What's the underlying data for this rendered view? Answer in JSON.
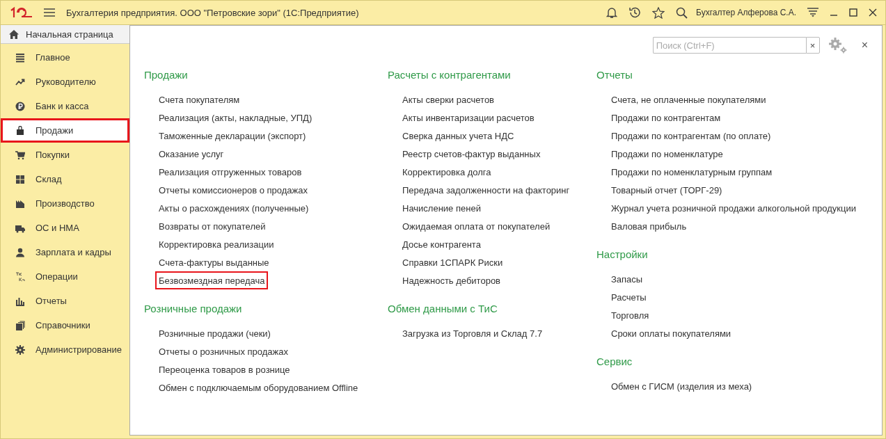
{
  "window": {
    "title": "Бухгалтерия предприятия. ООО \"Петровские зори\"  (1С:Предприятие)",
    "user": "Бухгалтер Алферова С.А."
  },
  "tabs": [
    {
      "label": "Начальная страница",
      "selected": false
    }
  ],
  "sidebar": {
    "items": [
      {
        "label": "Главное",
        "selected": false
      },
      {
        "label": "Руководителю",
        "selected": false
      },
      {
        "label": "Банк и касса",
        "selected": false
      },
      {
        "label": "Продажи",
        "selected": true
      },
      {
        "label": "Покупки",
        "selected": false
      },
      {
        "label": "Склад",
        "selected": false
      },
      {
        "label": "Производство",
        "selected": false
      },
      {
        "label": "ОС и НМА",
        "selected": false
      },
      {
        "label": "Зарплата и кадры",
        "selected": false
      },
      {
        "label": "Операции",
        "selected": false
      },
      {
        "label": "Отчеты",
        "selected": false
      },
      {
        "label": "Справочники",
        "selected": false
      },
      {
        "label": "Администрирование",
        "selected": false
      }
    ]
  },
  "search": {
    "placeholder": "Поиск (Ctrl+F)",
    "clear": "×"
  },
  "close": "×",
  "columns": [
    [
      {
        "title": "Продажи",
        "links": [
          {
            "label": "Счета покупателям",
            "selected": false
          },
          {
            "label": "Реализация (акты, накладные, УПД)",
            "selected": false
          },
          {
            "label": "Таможенные декларации (экспорт)",
            "selected": false
          },
          {
            "label": "Оказание услуг",
            "selected": false
          },
          {
            "label": "Реализация отгруженных товаров",
            "selected": false
          },
          {
            "label": "Отчеты комиссионеров о продажах",
            "selected": false
          },
          {
            "label": "Акты о расхождениях (полученные)",
            "selected": false
          },
          {
            "label": "Возвраты от покупателей",
            "selected": false
          },
          {
            "label": "Корректировка реализации",
            "selected": false
          },
          {
            "label": "Счета-фактуры выданные",
            "selected": false
          },
          {
            "label": "Безвозмездная передача",
            "selected": true
          }
        ]
      },
      {
        "title": "Розничные продажи",
        "links": [
          {
            "label": "Розничные продажи (чеки)",
            "selected": false
          },
          {
            "label": "Отчеты о розничных продажах",
            "selected": false
          },
          {
            "label": "Переоценка товаров в рознице",
            "selected": false
          },
          {
            "label": "Обмен с подключаемым оборудованием Offline",
            "selected": false
          }
        ]
      }
    ],
    [
      {
        "title": "Расчеты с контрагентами",
        "links": [
          {
            "label": "Акты сверки расчетов",
            "selected": false
          },
          {
            "label": "Акты инвентаризации расчетов",
            "selected": false
          },
          {
            "label": "Сверка данных учета НДС",
            "selected": false
          },
          {
            "label": "Реестр счетов-фактур выданных",
            "selected": false
          },
          {
            "label": "Корректировка долга",
            "selected": false
          },
          {
            "label": "Передача задолженности на факторинг",
            "selected": false
          },
          {
            "label": "Начисление пеней",
            "selected": false
          },
          {
            "label": "Ожидаемая оплата от покупателей",
            "selected": false
          },
          {
            "label": "Досье контрагента",
            "selected": false
          },
          {
            "label": "Справки 1СПАРК Риски",
            "selected": false
          },
          {
            "label": "Надежность дебиторов",
            "selected": false
          }
        ]
      },
      {
        "title": "Обмен данными с ТиС",
        "links": [
          {
            "label": "Загрузка из Торговля и Склад 7.7",
            "selected": false
          }
        ]
      }
    ],
    [
      {
        "title": "Отчеты",
        "links": [
          {
            "label": "Счета, не оплаченные покупателями",
            "selected": false
          },
          {
            "label": "Продажи по контрагентам",
            "selected": false
          },
          {
            "label": "Продажи по контрагентам (по оплате)",
            "selected": false
          },
          {
            "label": "Продажи по номенклатуре",
            "selected": false
          },
          {
            "label": "Продажи по номенклатурным группам",
            "selected": false
          },
          {
            "label": "Товарный отчет (ТОРГ-29)",
            "selected": false
          },
          {
            "label": "Журнал учета розничной продажи алкогольной продукции",
            "selected": false
          },
          {
            "label": "Валовая прибыль",
            "selected": false
          }
        ]
      },
      {
        "title": "Настройки",
        "links": [
          {
            "label": "Запасы",
            "selected": false
          },
          {
            "label": "Расчеты",
            "selected": false
          },
          {
            "label": "Торговля",
            "selected": false
          },
          {
            "label": "Сроки оплаты покупателями",
            "selected": false
          }
        ]
      },
      {
        "title": "Сервис",
        "links": [
          {
            "label": "Обмен с ГИСМ (изделия из меха)",
            "selected": false
          }
        ]
      }
    ]
  ]
}
